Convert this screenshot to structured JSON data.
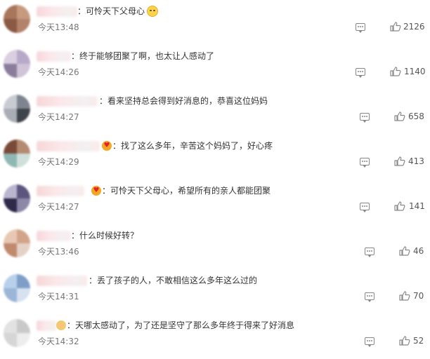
{
  "comments": [
    {
      "text": "：可怜天下父母心",
      "time": "今天13:48",
      "likes": "2126",
      "has_emoji": true,
      "has_badge": false
    },
    {
      "text": "：终于能够团聚了啊，也太让人感动了",
      "time": "今天14:26",
      "likes": "1140",
      "has_emoji": false,
      "has_badge": false
    },
    {
      "text": "：看来坚持总会得到好消息的，恭喜这位妈妈",
      "time": "今天14:27",
      "likes": "658",
      "has_emoji": false,
      "has_badge": false
    },
    {
      "text": "：找了这么多年，辛苦这个妈妈了，好心疼",
      "time": "今天14:29",
      "likes": "413",
      "has_emoji": false,
      "has_badge": true
    },
    {
      "text": "：可怜天下父母心，希望所有的亲人都能团聚",
      "time": "今天14:27",
      "likes": "141",
      "has_emoji": false,
      "has_badge": true
    },
    {
      "text": "：什么时候好转？",
      "time": "今天13:46",
      "likes": "46",
      "has_emoji": false,
      "has_badge": false
    },
    {
      "text": "：丢了孩子的人，不敢相信这么多年这么过的",
      "time": "今天14:31",
      "likes": "70",
      "has_emoji": false,
      "has_badge": false
    },
    {
      "text": "：天哪太感动了，为了还是坚守了那么多年终于得来了好消息",
      "time": "今天14:32",
      "likes": "52",
      "has_emoji": false,
      "has_badge": false
    }
  ],
  "icons": {
    "reply": "comment-icon",
    "like": "thumbs-up-icon",
    "emoji": "crying-face-emoji",
    "badge": "fan-badge-icon"
  },
  "colors": {
    "text": "#333333",
    "time": "#777777",
    "icon": "#888888"
  }
}
